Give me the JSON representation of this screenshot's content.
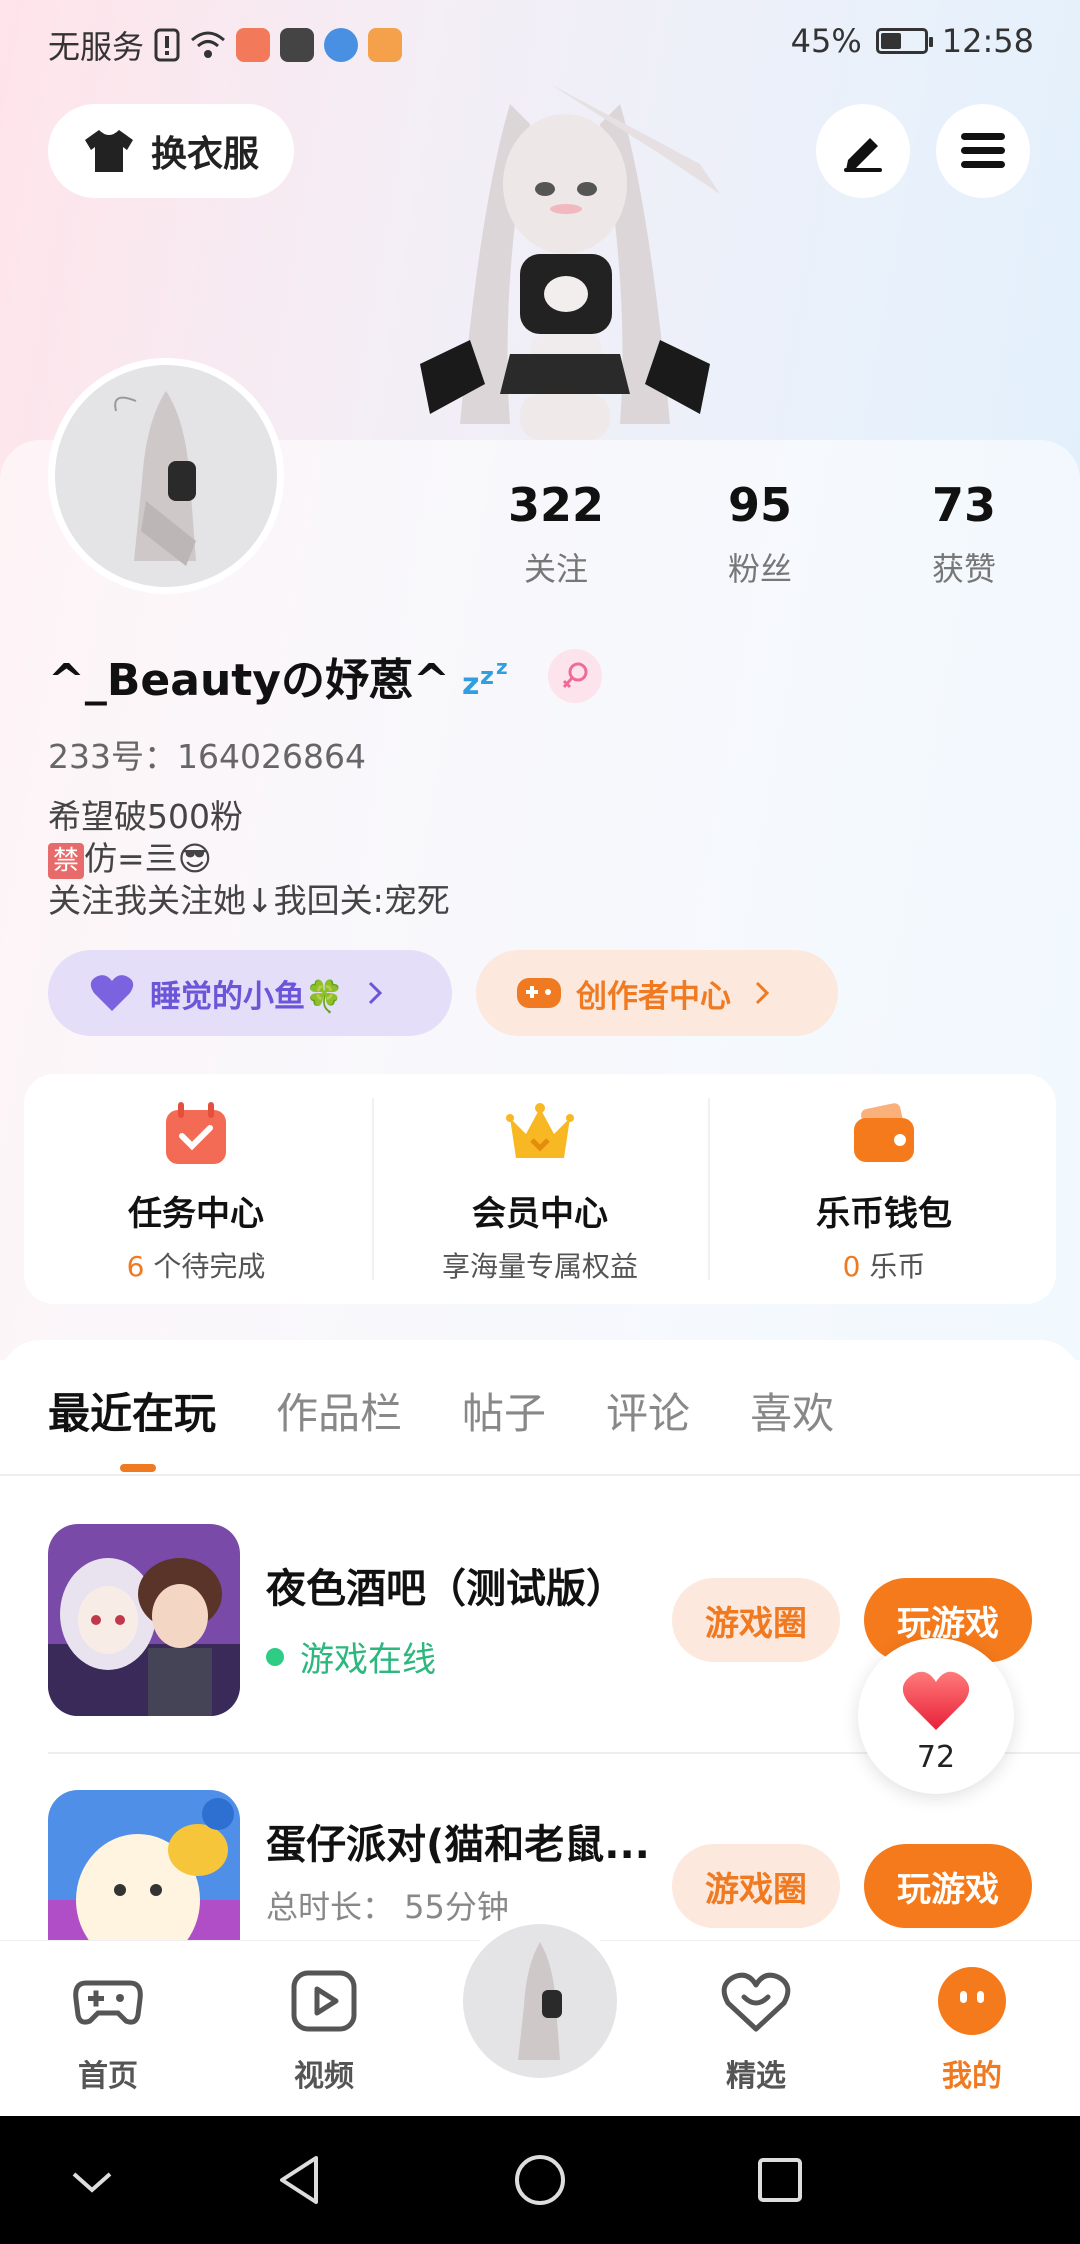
{
  "status_bar": {
    "carrier": "无服务",
    "battery": "45%",
    "battery_level": 0.45,
    "time": "12:58"
  },
  "header": {
    "outfit_label": "换衣服"
  },
  "profile": {
    "username": "^_Beautyの妤蒽^",
    "uid": "233号：164026864",
    "bio_line1": "希望破500粉",
    "bio_ban_badge": "禁",
    "bio_line2_rest": "仿=亖😎",
    "bio_line3": "关注我关注她↓我回关:宠死",
    "stats": [
      {
        "num": "322",
        "label": "关注"
      },
      {
        "num": "95",
        "label": "粉丝"
      },
      {
        "num": "73",
        "label": "获赞"
      }
    ],
    "pill_fish": "睡觉的小鱼🍀",
    "pill_creator": "创作者中心"
  },
  "quick": [
    {
      "title": "任务中心",
      "sub_num": "6",
      "sub_text": " 个待完成"
    },
    {
      "title": "会员中心",
      "sub_num": "",
      "sub_text": "享海量专属权益"
    },
    {
      "title": "乐币钱包",
      "sub_num": "0",
      "sub_text": " 乐币"
    }
  ],
  "tabs": [
    "最近在玩",
    "作品栏",
    "帖子",
    "评论",
    "喜欢"
  ],
  "games": [
    {
      "title": "夜色酒吧（测试版）",
      "status": "游戏在线",
      "circle_btn": "游戏圈",
      "play_btn": "玩游戏"
    },
    {
      "title": "蛋仔派对(猫和老鼠...",
      "meta": "总时长：  55分钟",
      "circle_btn": "游戏圈",
      "play_btn": "玩游戏"
    }
  ],
  "like_count": "72",
  "bottom_nav": [
    "首页",
    "视频",
    "精选",
    "我的"
  ],
  "colors": {
    "accent": "#f07a22",
    "online": "#2bb77d",
    "purple": "#6b55d8"
  }
}
